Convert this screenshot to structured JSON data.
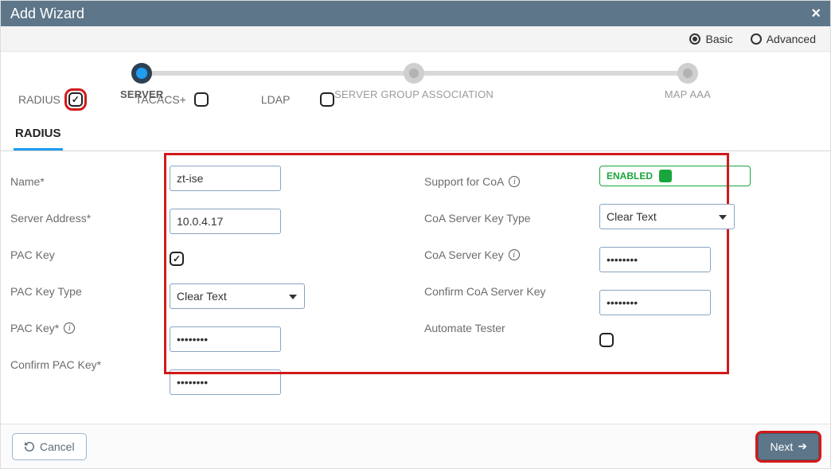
{
  "titlebar": {
    "title": "Add Wizard"
  },
  "modes": {
    "basic": "Basic",
    "advanced": "Advanced",
    "selected": "basic"
  },
  "steps": {
    "s1": "SERVER",
    "s2": "SERVER GROUP ASSOCIATION",
    "s3": "MAP AAA"
  },
  "protocols": {
    "radius": "RADIUS",
    "tacacs": "TACACS+",
    "ldap": "LDAP"
  },
  "tab": {
    "label": "RADIUS"
  },
  "labels": {
    "name": "Name*",
    "serverAddress": "Server Address*",
    "pacKeyToggle": "PAC Key",
    "pacKeyType": "PAC Key Type",
    "pacKey": "PAC Key*",
    "confirmPacKey": "Confirm PAC Key*",
    "supportCoA": "Support for CoA",
    "coaServerKeyType": "CoA Server Key Type",
    "coaServerKey": "CoA Server Key",
    "confirmCoaServerKey": "Confirm CoA Server Key",
    "automateTester": "Automate Tester"
  },
  "values": {
    "name": "zt-ise",
    "serverAddress": "10.0.4.17",
    "pacKeyType": "Clear Text",
    "pacKey": "••••••••",
    "confirmPacKey": "••••••••",
    "coaEnabled": "ENABLED",
    "coaServerKeyType": "Clear Text",
    "coaServerKey": "••••••••",
    "confirmCoaServerKey": "••••••••"
  },
  "footer": {
    "cancel": "Cancel",
    "next": "Next"
  }
}
